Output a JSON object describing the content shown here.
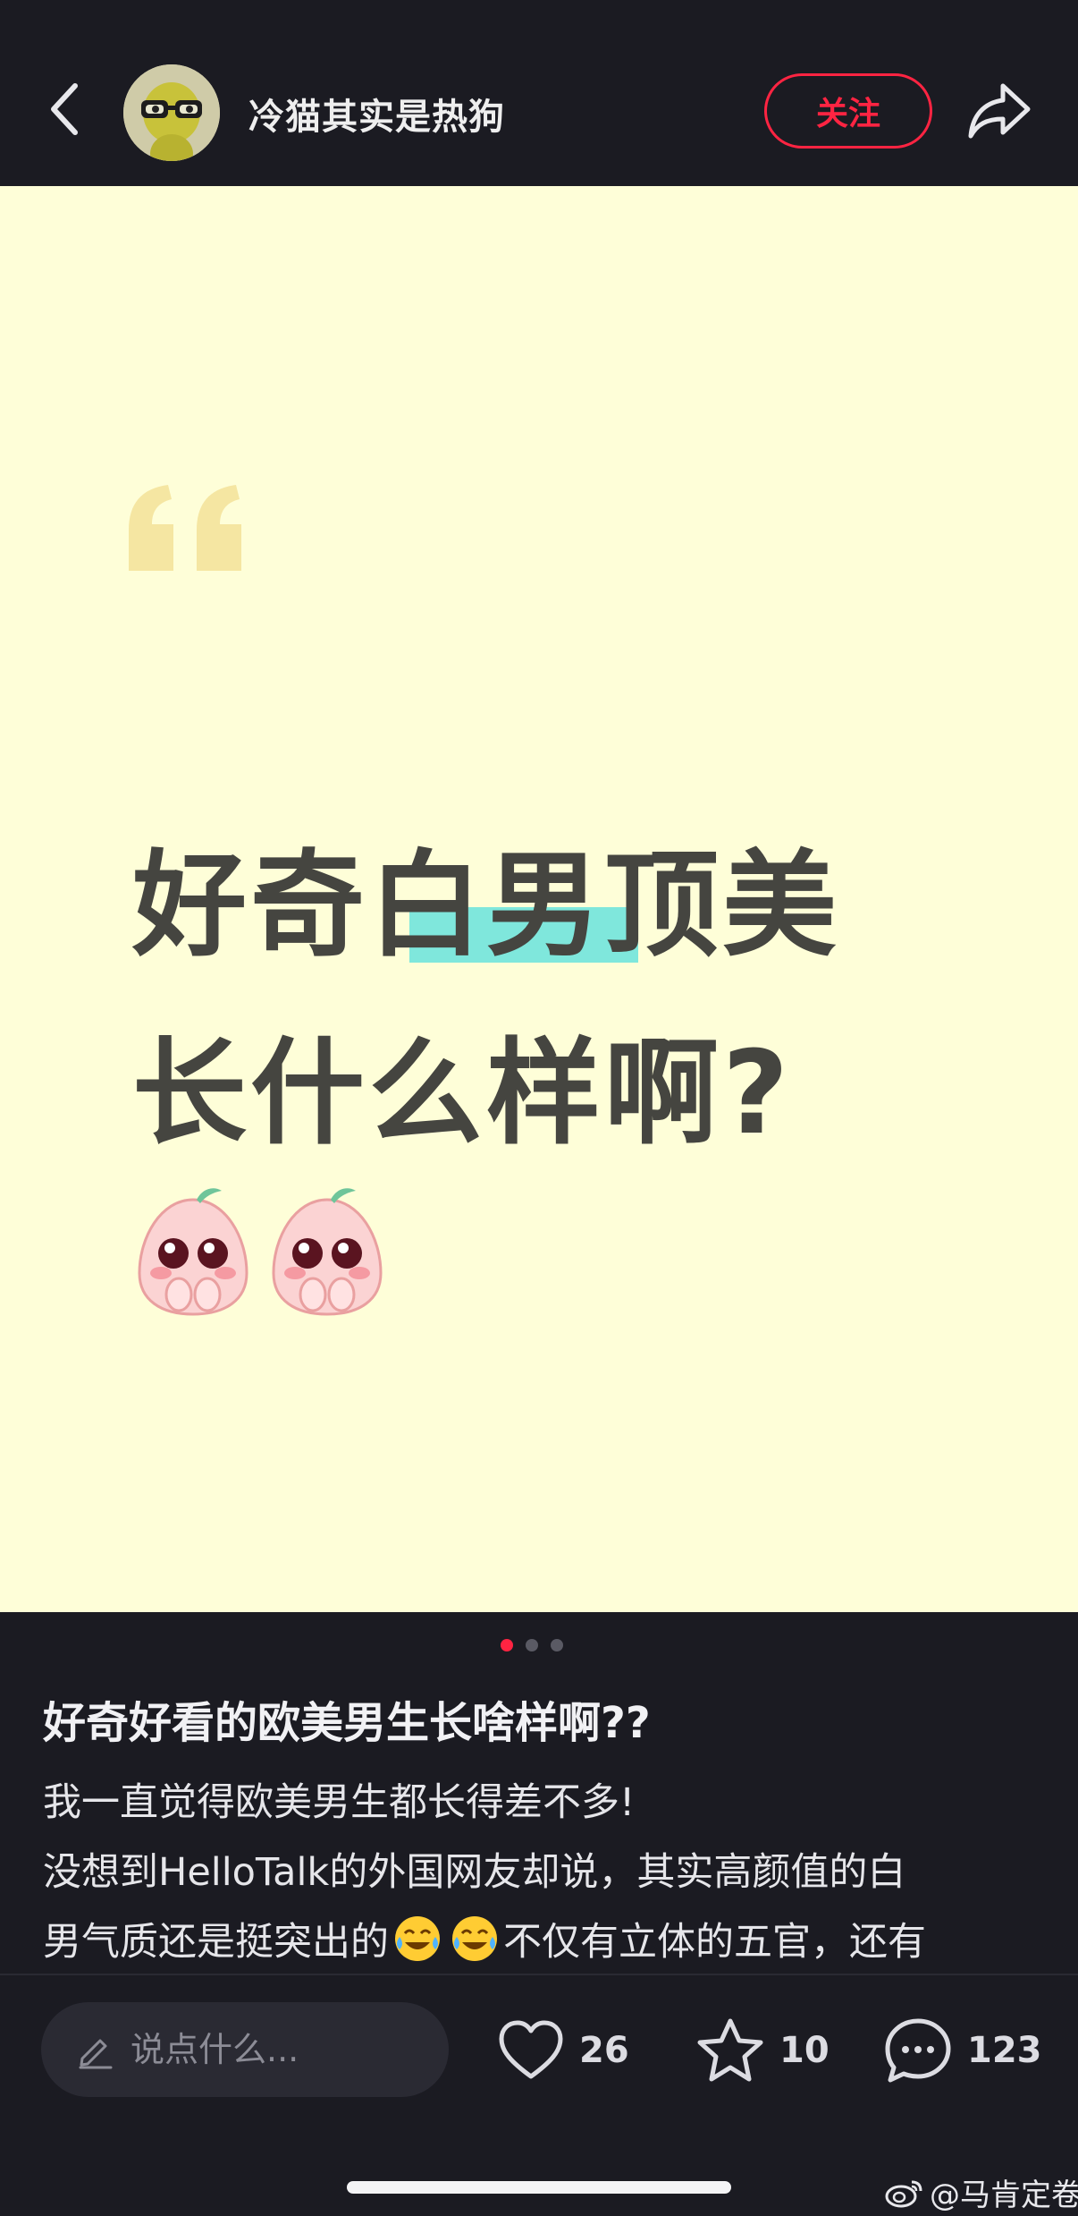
{
  "header": {
    "author_name": "冷猫其实是热狗",
    "follow_label": "关注",
    "back_icon": "chevron-left-icon",
    "share_icon": "share-arrow-icon"
  },
  "image": {
    "headline_line1": "好奇白男顶美",
    "headline_line2": "长什么样啊?",
    "highlighted_text": "白男",
    "background_color": "#fefed8",
    "highlight_color": "#7fe7dc",
    "emoji": "pleading-peach-emoji",
    "page_count": 3,
    "current_page": 1
  },
  "post": {
    "title": "好奇好看的欧美男生长啥样啊??",
    "body_line1": "我一直觉得欧美男生都长得差不多!",
    "body_line2": "没想到HelloTalk的外国网友却说，其实高颜值的白",
    "body_line3_start": "男气质还是挺突出的",
    "body_line3_end": "不仅有立体的五官，还有"
  },
  "bottom_bar": {
    "comment_placeholder": "说点什么...",
    "likes": "26",
    "favorites": "10",
    "comments": "123"
  },
  "watermark": {
    "text": "@马肯定卷"
  },
  "colors": {
    "accent": "#ff2442",
    "bar_background": "#1b1b22"
  }
}
